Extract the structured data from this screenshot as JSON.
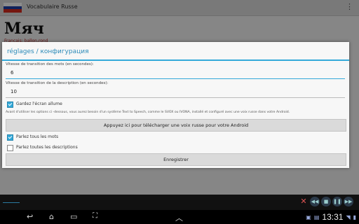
{
  "app": {
    "title": "Vocabulaire Russe",
    "overflow_icon": "overflow-menu-icon",
    "word": "Мяч",
    "translation": "Français: ballon,rond",
    "flag_colors": [
      "#ffffff",
      "#1c3fa8",
      "#d52b1e"
    ]
  },
  "dialog": {
    "title": "réglages / конфигурация",
    "word_speed_label": "Vitesse de transition des mots (en secondes):",
    "word_speed_value": "6",
    "desc_speed_label": "Vitesse de transition de la description (en secondes):",
    "desc_speed_value": "10",
    "keep_screen_on_label": "Gardez l'écran allume",
    "keep_screen_on": true,
    "info_text": "Avant d'utiliser les options ci -dessous, vous aurez besoin d'un système Text to Speech, comme le SVOX ou IVONA, installé et configuré avec une voix russe dans votre Android.",
    "download_voice_button": "Appuyez ici pour télécharger une voix russe pour votre Android",
    "speak_words_label": "Parlez tous les mots",
    "speak_words": true,
    "speak_descriptions_label": "Parlez toutes les descriptions",
    "speak_descriptions": false,
    "save_button": "Enregistrer",
    "accent_color": "#33a9d9"
  },
  "navbar": {
    "clock": "13:31",
    "icons": [
      "back-icon",
      "home-icon",
      "recent-apps-icon",
      "screenshot-icon",
      "up-chevron-icon",
      "close-icon",
      "rewind-icon",
      "stop-icon",
      "pause-icon",
      "forward-icon",
      "wifi-icon",
      "battery-icon"
    ]
  }
}
